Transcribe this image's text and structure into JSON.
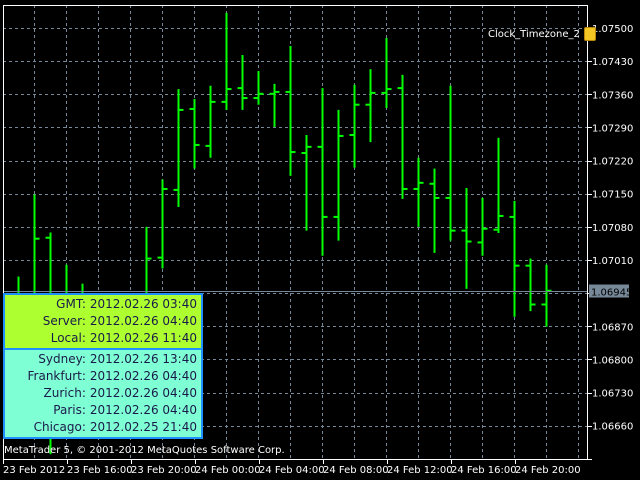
{
  "colors": {
    "background": "#000000",
    "bars": "#00ff00",
    "grid": "#778899",
    "axis": "#ffffff",
    "gmt_panel": "#adff2f",
    "zones_panel": "#7fffd4",
    "panel_border": "#1e90ff",
    "price_label_bg": "#778899"
  },
  "expert": {
    "name": "Clock_Timezone_2",
    "icon": "scroll-icon"
  },
  "price_axis": {
    "ticks": [
      "1.07500",
      "1.07430",
      "1.07360",
      "1.07290",
      "1.07220",
      "1.07150",
      "1.07080",
      "1.07010",
      "1.06870",
      "1.06800",
      "1.06730",
      "1.06660"
    ],
    "current_price": "1.06945"
  },
  "time_axis": {
    "ticks": [
      "23 Feb 2012",
      "23 Feb 16:00",
      "23 Feb 20:00",
      "24 Feb 00:00",
      "24 Feb 04:00",
      "24 Feb 08:00",
      "24 Feb 12:00",
      "24 Feb 16:00",
      "24 Feb 20:00"
    ]
  },
  "chart_data": {
    "type": "ohlc",
    "timeframe_bars_ohlc": [
      [
        1.0691,
        1.06975,
        1.0684,
        1.069
      ],
      [
        1.069,
        1.07148,
        1.0682,
        1.07055
      ],
      [
        1.07057,
        1.07068,
        1.066,
        1.0689
      ],
      [
        1.0689,
        1.07,
        1.0678,
        1.0686
      ],
      [
        1.0686,
        1.0696,
        1.0675,
        1.0683
      ],
      [
        1.0683,
        1.0692,
        1.0672,
        1.068
      ],
      [
        1.068,
        1.069,
        1.0671,
        1.0685
      ],
      [
        1.0685,
        1.0693,
        1.0678,
        1.069
      ],
      [
        1.069,
        1.0708,
        1.0684,
        1.07013
      ],
      [
        1.07015,
        1.0718,
        1.06992,
        1.0716
      ],
      [
        1.07158,
        1.07371,
        1.07122,
        1.07327
      ],
      [
        1.07329,
        1.0735,
        1.07203,
        1.07253
      ],
      [
        1.07251,
        1.07378,
        1.07226,
        1.07344
      ],
      [
        1.07344,
        1.07532,
        1.07327,
        1.07371
      ],
      [
        1.07373,
        1.07443,
        1.07327,
        1.07352
      ],
      [
        1.07352,
        1.07409,
        1.07338,
        1.07361
      ],
      [
        1.07361,
        1.07382,
        1.07291,
        1.07365
      ],
      [
        1.07365,
        1.07462,
        1.07188,
        1.07238
      ],
      [
        1.07236,
        1.07274,
        1.07072,
        1.07249
      ],
      [
        1.07249,
        1.07373,
        1.07019,
        1.07101
      ],
      [
        1.07101,
        1.07327,
        1.07051,
        1.07272
      ],
      [
        1.07274,
        1.0738,
        1.07205,
        1.07338
      ],
      [
        1.07338,
        1.07413,
        1.07259,
        1.07363
      ],
      [
        1.07363,
        1.07479,
        1.07331,
        1.07371
      ],
      [
        1.07373,
        1.07401,
        1.07139,
        1.0716
      ],
      [
        1.0716,
        1.07226,
        1.0708,
        1.07173
      ],
      [
        1.07171,
        1.07203,
        1.07025,
        1.07141
      ],
      [
        1.07141,
        1.07378,
        1.07051,
        1.07072
      ],
      [
        1.07072,
        1.07162,
        1.06949,
        1.07049
      ],
      [
        1.07047,
        1.07141,
        1.07019,
        1.07076
      ],
      [
        1.07074,
        1.07268,
        1.07067,
        1.07103
      ],
      [
        1.07101,
        1.07135,
        1.0689,
        1.06998
      ],
      [
        1.06998,
        1.07013,
        1.06902,
        1.06916
      ],
      [
        1.06916,
        1.07,
        1.06869,
        1.06945
      ]
    ],
    "ylim": [
      1.0658,
      1.0755
    ],
    "grid": true
  },
  "clock": {
    "main": [
      {
        "label": "GMT:",
        "value": "2012.02.26 03:40"
      },
      {
        "label": "Server:",
        "value": "2012.02.26 04:40"
      },
      {
        "label": "Local:",
        "value": "2012.02.26 11:40"
      }
    ],
    "zones": [
      {
        "label": "Sydney:",
        "value": "2012.02.26 13:40"
      },
      {
        "label": "Frankfurt:",
        "value": "2012.02.26 04:40"
      },
      {
        "label": "Zurich:",
        "value": "2012.02.26 04:40"
      },
      {
        "label": "Paris:",
        "value": "2012.02.26 04:40"
      },
      {
        "label": "Chicago:",
        "value": "2012.02.25 21:40"
      }
    ]
  },
  "copyright": "MetaTrader 5, © 2001-2012 MetaQuotes Software Corp."
}
